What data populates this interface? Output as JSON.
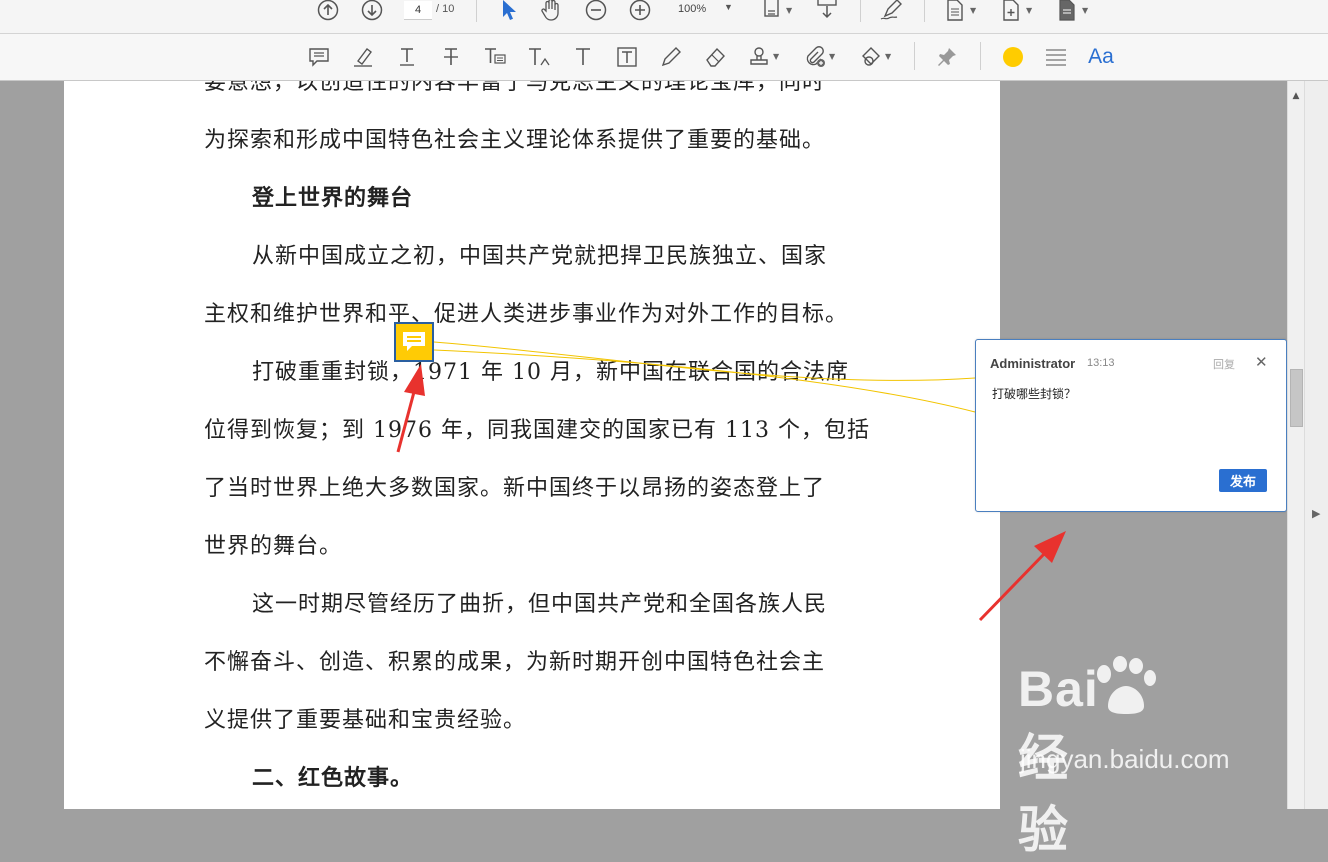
{
  "toolbar_top": {
    "page_input": "4",
    "page_total": "/ 10",
    "zoom": "100%",
    "icons": [
      "prev-page-icon",
      "next-page-icon",
      "select-cursor-icon",
      "hand-tool-icon",
      "zoom-out-icon",
      "zoom-in-icon",
      "fit-page-icon",
      "scroll-mode-icon",
      "sign-pen-icon",
      "document-icon",
      "document-add-icon",
      "document-pages-icon"
    ]
  },
  "toolbar_comment": {
    "font_button": "Aa",
    "highlight_color": "#ffcc00",
    "icons": [
      "sticky-note-icon",
      "highlighter-icon",
      "underline-text-icon",
      "strikethrough-text-icon",
      "replace-text-icon",
      "insert-text-icon",
      "text-box-icon",
      "text-field-icon",
      "pencil-icon",
      "eraser-icon",
      "stamp-icon",
      "attach-file-icon",
      "shapes-icon",
      "pin-icon",
      "color-swatch-icon",
      "line-style-icon"
    ]
  },
  "document": {
    "lines": [
      "要意想，以创造性的内容丰富了马克思主义的理论宝库，同时",
      "为探索和形成中国特色社会主义理论体系提供了重要的基础。",
      "登上世界的舞台",
      "从新中国成立之初，中国共产党就把捍卫民族独立、国家",
      "主权和维护世界和平、促进人类进步事业作为对外工作的目标。",
      "打破重重封锁，1971 年 10 月，新中国在联合国的合法席",
      "位得到恢复；到 1976 年，同我国建交的国家已有 113 个，包括",
      "了当时世界上绝大多数国家。新中国终于以昂扬的姿态登上了",
      "世界的舞台。",
      "这一时期尽管经历了曲折，但中国共产党和全国各族人民",
      "不懈奋斗、创造、积累的成果，为新时期开创中国特色社会主",
      "义提供了重要基础和宝贵经验。",
      "二、红色故事。"
    ]
  },
  "comment": {
    "author": "Administrator",
    "time": "13:13",
    "reply": "回复",
    "close": "✕",
    "text": "打破哪些封锁？",
    "publish": "发布"
  },
  "watermark": {
    "brand": "Bai 经验",
    "url": "jingyan.baidu.com"
  },
  "colors": {
    "accent": "#2a6fd1",
    "note_yellow": "#ffcb05",
    "arrow_red": "#e8322e",
    "popup_border": "#4a7fbf"
  }
}
